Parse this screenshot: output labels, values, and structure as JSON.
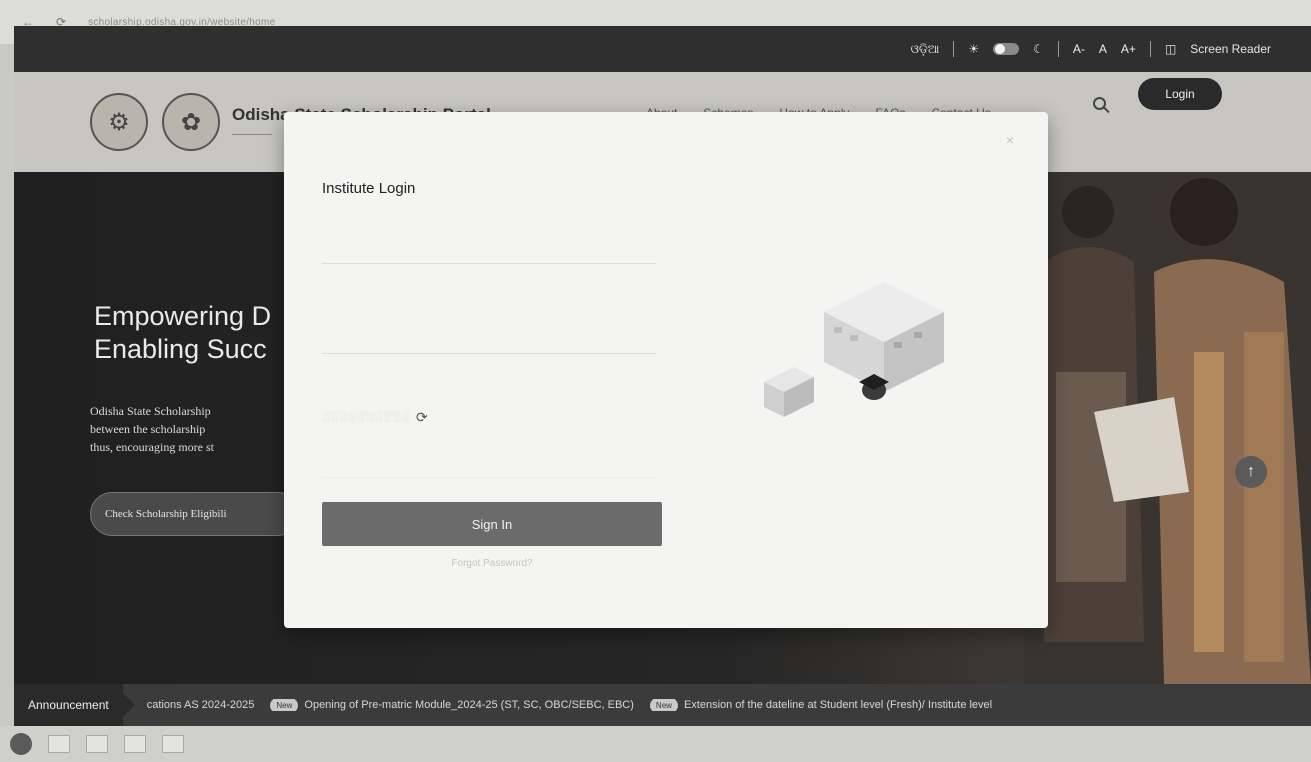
{
  "browser": {
    "url": "scholarship.odisha.gov.in/website/home"
  },
  "accessibility": {
    "language": "ଓଡ଼ିଆ",
    "font_small": "A-",
    "font_normal": "A",
    "font_large": "A+",
    "screen_reader": "Screen Reader"
  },
  "header": {
    "title": "Odisha State Scholarship Portal",
    "nav": [
      "About",
      "Schemes",
      "How to Apply",
      "FAQs",
      "Contact Us"
    ],
    "login_label": "Login"
  },
  "hero": {
    "heading_line1": "Empowering D",
    "heading_line2": "Enabling Succ",
    "desc_line1": "Odisha State Scholarship",
    "desc_line2": "between the scholarship",
    "desc_line3": "thus, encouraging more st",
    "eligibility_label": "Check Scholarship Eligibili"
  },
  "modal": {
    "title": "Institute Login",
    "signin_label": "Sign In",
    "forgot_label": "Forgot Password?"
  },
  "announcement": {
    "label": "Announcement",
    "item1": "cations AS 2024-2025",
    "badge": "New",
    "item2": "Opening of Pre-matric Module_2024-25 (ST, SC, OBC/SEBC, EBC)",
    "item3": "Extension of the dateline at Student level (Fresh)/ Institute level"
  },
  "colors": {
    "dark": "#2a2a2a",
    "modal_bg": "#f4f4f2",
    "signin_bg": "#6b6b6b"
  }
}
